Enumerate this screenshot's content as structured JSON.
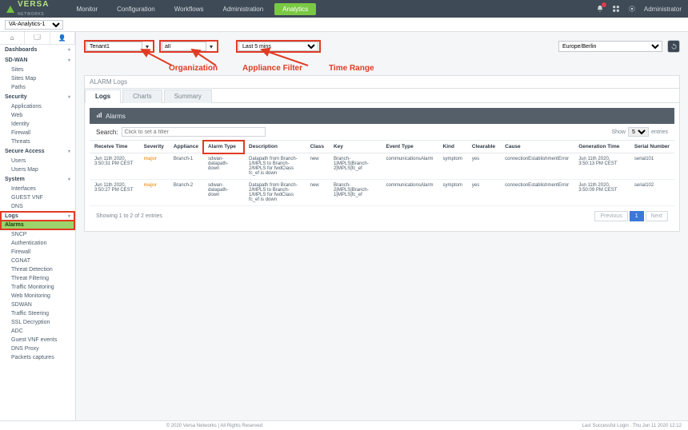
{
  "brand": {
    "name": "VERSA",
    "sub": "NETWORKS"
  },
  "topnav": {
    "items": [
      "Monitor",
      "Configuration",
      "Workflows",
      "Administration",
      "Analytics"
    ],
    "active": 4
  },
  "header_user": "Administrator",
  "icons": {
    "bell": "bell-icon",
    "grid": "grid-icon",
    "gear": "gear-icon"
  },
  "subheader": {
    "org_select": "VA-Analytics-1"
  },
  "iconbar": [
    "⌂",
    "🗔",
    "👤"
  ],
  "sidebar": {
    "dashboards_label": "Dashboards",
    "groups": [
      {
        "label": "SD-WAN",
        "items": [
          "Sites",
          "Sites Map",
          "Paths"
        ]
      },
      {
        "label": "Security",
        "items": [
          "Applications",
          "Web",
          "Identity",
          "Firewall",
          "Threats"
        ]
      },
      {
        "label": "Secure Access",
        "items": [
          "Users",
          "Users Map"
        ]
      },
      {
        "label": "System",
        "items": [
          "Interfaces",
          "GUEST VNF",
          "DNS"
        ]
      }
    ],
    "logs_label": "Logs",
    "logs_items": [
      "Alarms",
      "SNCP",
      "Authentication",
      "Firewall",
      "CGNAT",
      "Threat Detection",
      "Threat Filtering",
      "Traffic Monitoring",
      "Web Monitoring",
      "SDWAN",
      "Traffic Steering",
      "SSL Decryption",
      "ADC",
      "Guest VNF events",
      "DNS Proxy",
      "Packets captures"
    ],
    "logs_active": 0
  },
  "filters": {
    "org_value": "Tenant1",
    "appliance_value": "all",
    "range_value": "Last 5 mins",
    "timezone": "Europe/Berlin"
  },
  "annotations": {
    "org": "Organization",
    "appl": "Appliance Filter",
    "range": "Time Range"
  },
  "panel": {
    "title": "ALARM Logs",
    "tabs": [
      "Logs",
      "Charts",
      "Summary"
    ],
    "tab_active": 0,
    "card_title": "Alarms",
    "search_label": "Search:",
    "search_placeholder": "Click to set a filter",
    "show_label": "Show",
    "show_value": "5",
    "entries_label": "entries",
    "columns": [
      "Receive Time",
      "Severity",
      "Appliance",
      "Alarm Type",
      "Description",
      "Class",
      "Key",
      "Event Type",
      "Kind",
      "Clearable",
      "Cause",
      "Generation Time",
      "Serial Number"
    ],
    "rows": [
      {
        "time": "Jun 11th 2020, 3:50:31 PM CEST",
        "sev": "major",
        "appl": "Branch-1",
        "atype": "sdwan-datapath-down",
        "desc": "Datapath from Branch-1/MPLS to Branch-2/MPLS for fwdClass fc_ef is down",
        "cls": "new",
        "key": "Branch-1|MPLS|Branch-2|MPLS|fc_ef",
        "etype": "communicationsAlarm",
        "kind": "symptom",
        "clr": "yes",
        "cause": "connectionEstablishmentError",
        "gen": "Jun 11th 2020, 3:50:13 PM CEST",
        "serial": "serial101"
      },
      {
        "time": "Jun 11th 2020, 3:50:27 PM CEST",
        "sev": "major",
        "appl": "Branch-2",
        "atype": "sdwan-datapath-down",
        "desc": "Datapath from Branch-2/MPLS to Branch-1/MPLS for fwdClass fc_ef is down",
        "cls": "new",
        "key": "Branch-2|MPLS|Branch-1|MPLS|fc_ef",
        "etype": "communicationsAlarm",
        "kind": "symptom",
        "clr": "yes",
        "cause": "connectionEstablishmentError",
        "gen": "Jun 11th 2020, 3:50:09 PM CEST",
        "serial": "serial102"
      }
    ],
    "summary": "Showing 1 to 2 of 2 entries",
    "pager": {
      "prev": "Previous",
      "page": "1",
      "next": "Next"
    }
  },
  "footer": {
    "copy": "© 2020 Versa Networks | All Rights Reserved",
    "login": "Last Successful Login : Thu Jun 11 2020 12:12"
  }
}
